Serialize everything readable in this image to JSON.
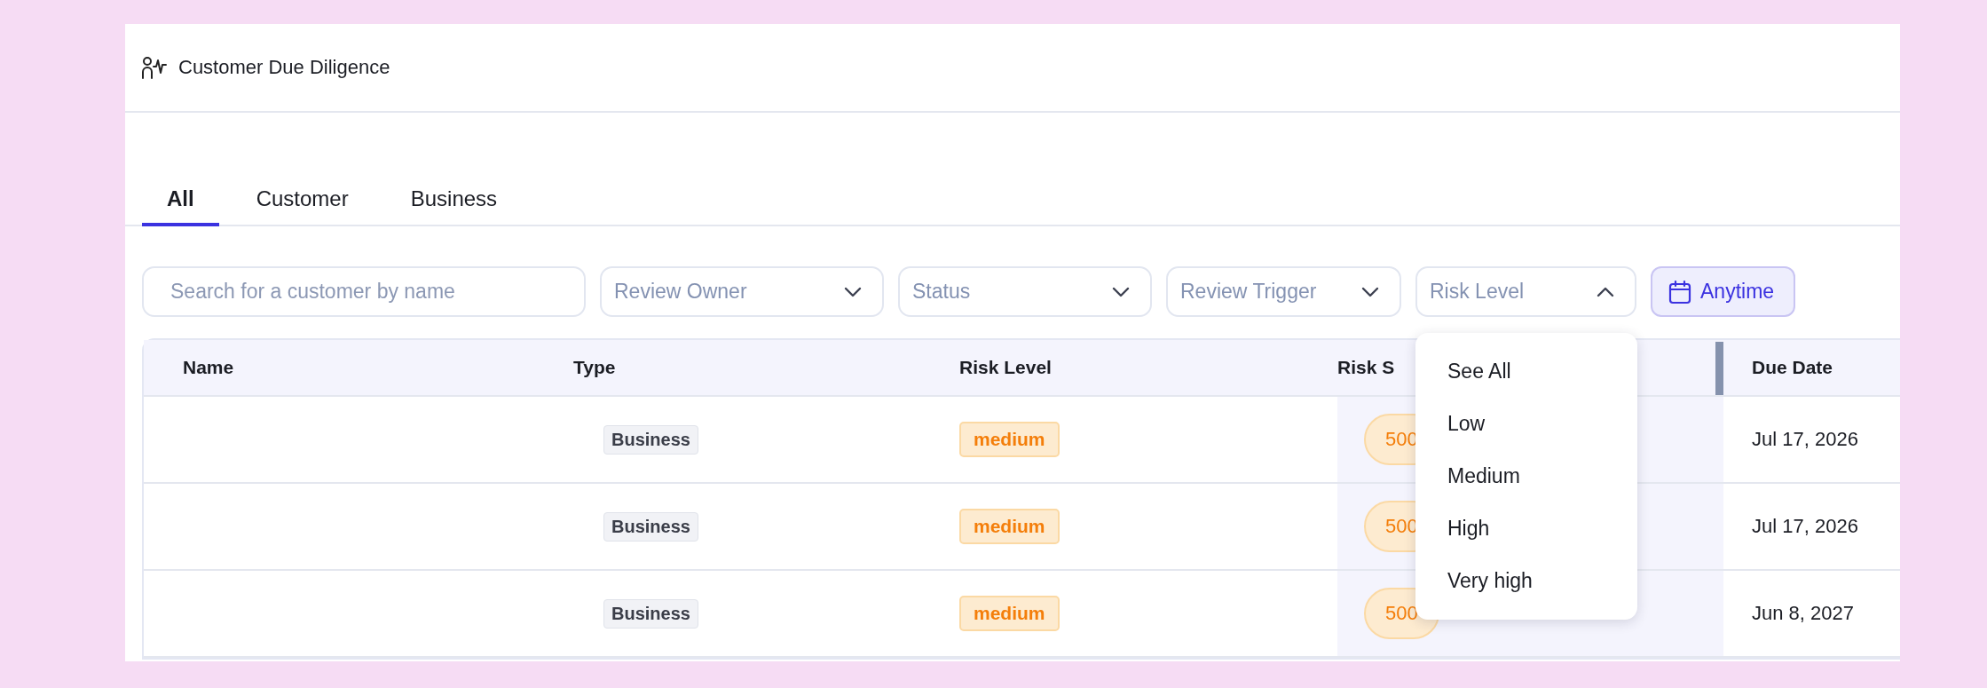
{
  "page": {
    "title": "Customer Due Diligence"
  },
  "tabs": [
    {
      "label": "All",
      "selected": true
    },
    {
      "label": "Customer",
      "selected": false
    },
    {
      "label": "Business",
      "selected": false
    }
  ],
  "search": {
    "placeholder": "Search for a customer by name"
  },
  "filters": [
    {
      "placeholder": "Review Owner",
      "expanded": false
    },
    {
      "placeholder": "Status",
      "expanded": false
    },
    {
      "placeholder": "Review Trigger",
      "expanded": false
    },
    {
      "placeholder": "Risk Level",
      "expanded": true,
      "options": [
        "See All",
        "Low",
        "Medium",
        "High",
        "Very high"
      ]
    }
  ],
  "date_filter": {
    "label": "Anytime"
  },
  "table": {
    "columns": [
      "Name",
      "Type",
      "Risk Level",
      "Risk S",
      "Due Date"
    ],
    "rows": [
      {
        "type": "Business",
        "risk_level": "medium",
        "risk_score": "500",
        "due_date": "Jul 17, 2026"
      },
      {
        "type": "Business",
        "risk_level": "medium",
        "risk_score": "500",
        "due_date": "Jul 17, 2026"
      },
      {
        "type": "Business",
        "risk_level": "medium",
        "risk_score": "500",
        "due_date": "Jun 8, 2027"
      }
    ]
  }
}
